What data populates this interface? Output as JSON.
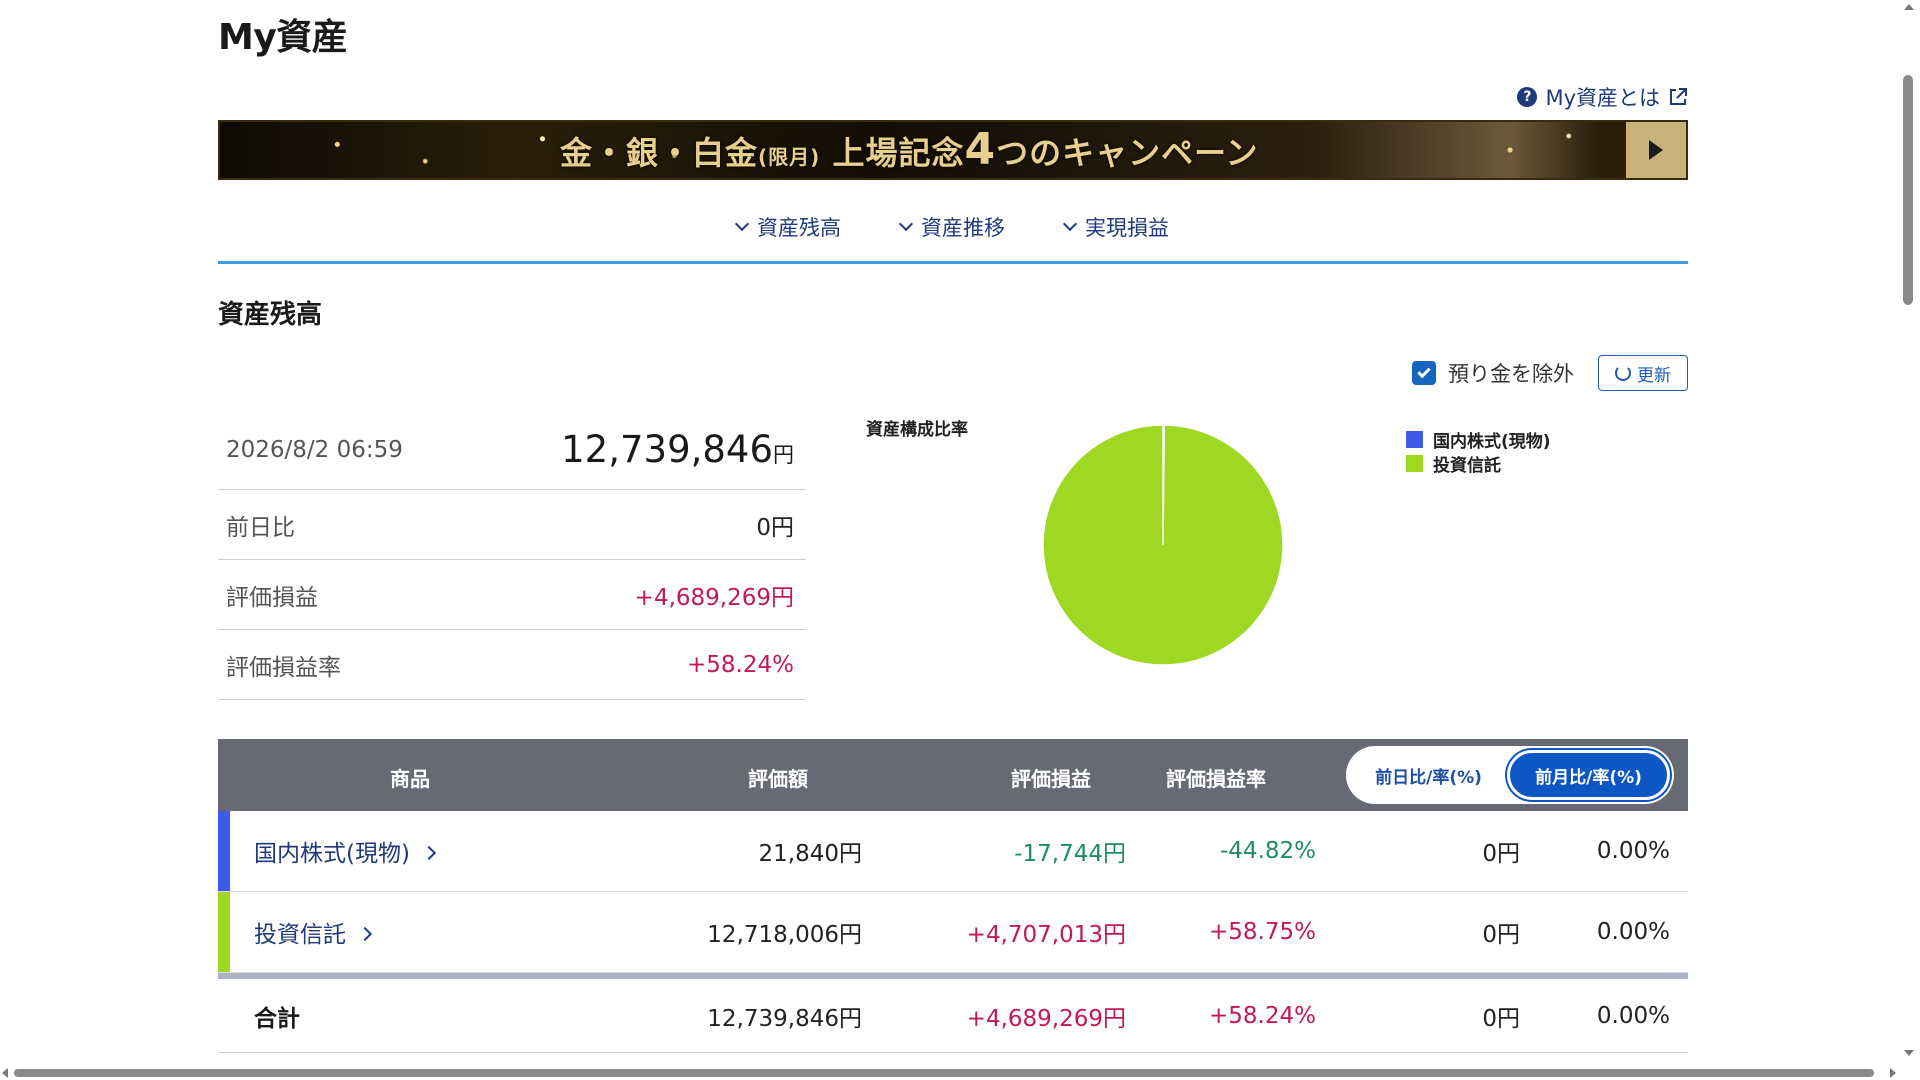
{
  "page": {
    "title": "My資産",
    "help_link": "My資産とは",
    "banner": {
      "text_prefix": "金・銀・白金",
      "text_paren": "(限月)",
      "text_main_a": "上場記念",
      "text_num": "4",
      "text_main_b": "つのキャンペーン"
    },
    "nav": [
      "資産残高",
      "資産推移",
      "実現損益"
    ]
  },
  "balance": {
    "section_title": "資産残高",
    "exclude_label": "預り金を除外",
    "exclude_checked": true,
    "refresh_label": "更新",
    "datetime": "2026/8/2 06:59",
    "total": "12,739,846",
    "total_unit": "円",
    "rows": [
      {
        "label": "前日比",
        "value": "0円"
      },
      {
        "label": "評価損益",
        "value": "+4,689,269円"
      },
      {
        "label": "評価損益率",
        "value": "+58.24%"
      }
    ]
  },
  "chart_data": {
    "type": "pie",
    "title": "資産構成比率",
    "legend_position": "top-right",
    "series": [
      {
        "name": "国内株式(現物)",
        "value": 21840,
        "color": "#3d5be8"
      },
      {
        "name": "投資信託",
        "value": 12718006,
        "color": "#9ed823"
      }
    ]
  },
  "table": {
    "headers": {
      "product": "商品",
      "value": "評価額",
      "pl": "評価損益",
      "pl_rate": "評価損益率"
    },
    "toggle": {
      "daily": "前日比/率(%)",
      "monthly": "前月比/率(%)",
      "active": "monthly"
    },
    "rows": [
      {
        "name": "国内株式(現物)",
        "color": "#3d5be8",
        "value": "21,840円",
        "pl": "-17,744円",
        "pl_rate": "-44.82%",
        "change": "0円",
        "change_rate": "0.00%"
      },
      {
        "name": "投資信託",
        "color": "#9ed823",
        "value": "12,718,006円",
        "pl": "+4,707,013円",
        "pl_rate": "+58.75%",
        "change": "0円",
        "change_rate": "0.00%"
      }
    ],
    "total": {
      "name": "合計",
      "value": "12,739,846円",
      "pl": "+4,689,269円",
      "pl_rate": "+58.24%",
      "change": "0円",
      "change_rate": "0.00%"
    }
  }
}
